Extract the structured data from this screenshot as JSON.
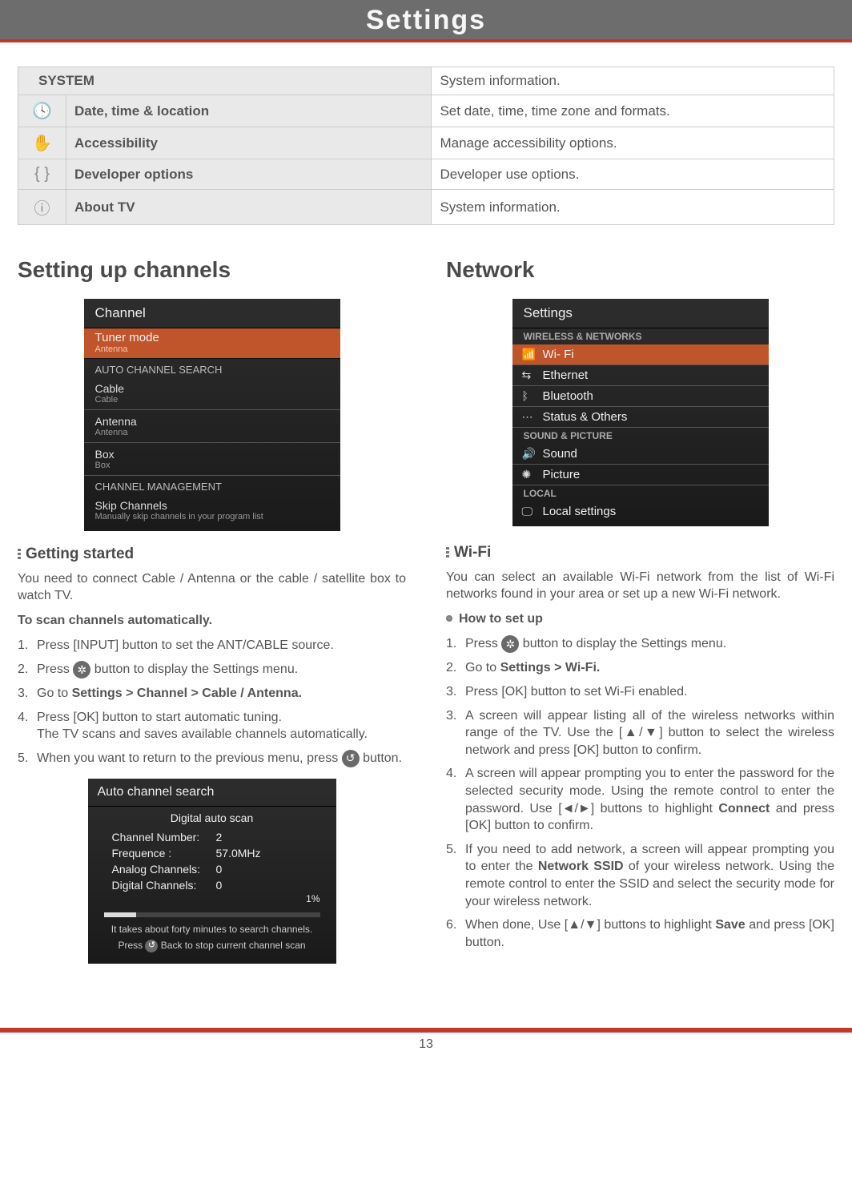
{
  "page_title": "Settings",
  "page_number": "13",
  "top_table": {
    "system": {
      "label": "SYSTEM",
      "desc": "System information."
    },
    "rows": [
      {
        "icon": "🕓",
        "label": "Date, time & location",
        "desc": "Set date, time, time zone and formats."
      },
      {
        "icon": "✋",
        "label": "Accessibility",
        "desc": "Manage accessibility options."
      },
      {
        "icon": "{ }",
        "label": "Developer options",
        "desc": "Developer use options."
      },
      {
        "icon": "ⓘ",
        "label": "About TV",
        "desc": "System information."
      }
    ]
  },
  "left": {
    "heading": "Setting up channels",
    "channel_panel": {
      "title": "Channel",
      "tuner_mode": {
        "l1": "Tuner mode",
        "l2": "Antenna"
      },
      "auto_search_head": "AUTO CHANNEL SEARCH",
      "items": [
        {
          "l1": "Cable",
          "l2": "Cable"
        },
        {
          "l1": "Antenna",
          "l2": "Antenna"
        },
        {
          "l1": "Box",
          "l2": "Box"
        }
      ],
      "mgmt_head": "CHANNEL MANAGEMENT",
      "skip": {
        "l1": "Skip Channels",
        "l2": "Manually skip channels in your program list"
      }
    },
    "getting_started_head": "Getting started",
    "intro": "You need to connect Cable / Antenna or the cable / satellite box to watch TV.",
    "scan_head": "To scan channels automatically.",
    "steps": {
      "s1": "Press [INPUT] button to set the ANT/CABLE source.",
      "s2a": "Press ",
      "s2b": " button to display the Settings menu.",
      "s3a": "Go to ",
      "s3b": "Settings > Channel > Cable / Antenna.",
      "s4a": "Press [OK] button to start automatic tuning.",
      "s4b": "The TV scans and saves available channels automatically.",
      "s5a": "When you want to return to the previous menu, press ",
      "s5b": " button."
    },
    "auto_panel": {
      "title": "Auto channel search",
      "sub": "Digital auto scan",
      "kv": [
        {
          "k": "Channel Number:",
          "v": "2"
        },
        {
          "k": "Frequence           :",
          "v": "57.0MHz"
        },
        {
          "k": "Analog Channels:",
          "v": "0"
        },
        {
          "k": "Digital Channels:",
          "v": "0"
        }
      ],
      "pct": "1%",
      "note1": "It takes about forty minutes to search channels.",
      "note2a": "Press ",
      "note2b": " Back to stop current channel scan"
    }
  },
  "right": {
    "heading": "Network",
    "settings_panel": {
      "title": "Settings",
      "cat1": "WIRELESS & NETWORKS",
      "rows1": [
        {
          "icon": "📶",
          "label": "Wi- Fi",
          "hi": true
        },
        {
          "icon": "⇆",
          "label": "Ethernet"
        },
        {
          "icon": "ᛒ",
          "label": "Bluetooth"
        },
        {
          "icon": "⋯",
          "label": "Status & Others"
        }
      ],
      "cat2": "SOUND & PICTURE",
      "rows2": [
        {
          "icon": "🔊",
          "label": "Sound"
        },
        {
          "icon": "✺",
          "label": "Picture"
        }
      ],
      "cat3": "LOCAL",
      "rows3": [
        {
          "icon": "🖵",
          "label": "Local settings"
        }
      ]
    },
    "wifi_head": "Wi-Fi",
    "wifi_intro": "You can select an available Wi-Fi network from the list of Wi-Fi networks found in your area or set up a new Wi-Fi network.",
    "howto": "How to set up",
    "steps": {
      "s1a": "Press ",
      "s1b": " button to display the Settings menu.",
      "s2a": "Go to ",
      "s2b": "Settings > Wi-Fi.",
      "s3": "Press [OK] button to set Wi-Fi enabled.",
      "s3b": "A screen will appear listing all of the wireless networks within range of the TV. Use the [▲/▼] button to select the wireless network and press [OK] button to confirm.",
      "s4a": "A screen will appear prompting you to enter the password for the selected security mode. Using the remote control to enter the password. Use [◄/►] buttons to highlight ",
      "s4b": "Connect",
      "s4c": " and press [OK] button to confirm.",
      "s5a": "If you need to add network, a screen will appear prompting you to enter the ",
      "s5b": "Network SSID",
      "s5c": " of your wireless network. Using the remote control to enter the SSID and select the security mode for your wireless network.",
      "s6a": "When done, Use [▲/▼] buttons to highlight ",
      "s6b": "Save",
      "s6c": " and press [OK] button."
    }
  }
}
